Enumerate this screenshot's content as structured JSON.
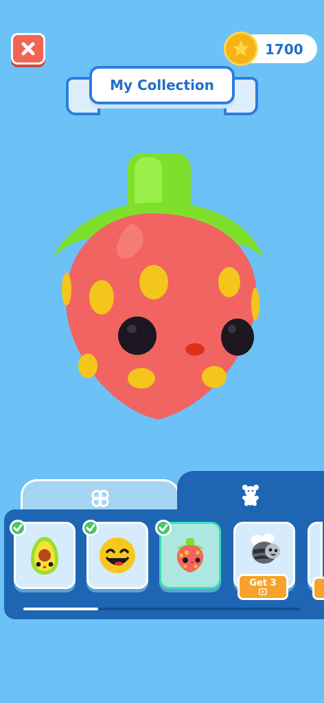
{
  "header": {
    "close_icon": "close-x-icon",
    "coin_icon": "gold-coin-icon",
    "coins": "1700",
    "title": "My Collection"
  },
  "colors": {
    "background": "#6cc2f7",
    "accent_blue": "#1f6fc8",
    "close_red": "#f26552",
    "coin_gold": "#f5b316",
    "panel_blue": "#1e66b4",
    "check_green": "#4cc46a",
    "offer_orange": "#f6a32c"
  },
  "hero": {
    "character": "strawberry",
    "icon": "strawberry-character-icon"
  },
  "tabs": [
    {
      "icon": "grid-flower-icon",
      "selected": false
    },
    {
      "icon": "teddy-bear-icon",
      "selected": true
    }
  ],
  "collection": {
    "items": [
      {
        "character": "avocado",
        "icon": "avocado-icon",
        "owned": true,
        "selected": false
      },
      {
        "character": "smiling face",
        "icon": "smiley-face-icon",
        "owned": true,
        "selected": false
      },
      {
        "character": "strawberry",
        "icon": "strawberry-icon",
        "owned": true,
        "selected": true
      },
      {
        "character": "bee",
        "icon": "bee-icon",
        "owned": false,
        "selected": false,
        "offer_label": "Get 3",
        "offer_icon": "video-play-icon"
      }
    ],
    "scroll_progress": 0.27
  }
}
